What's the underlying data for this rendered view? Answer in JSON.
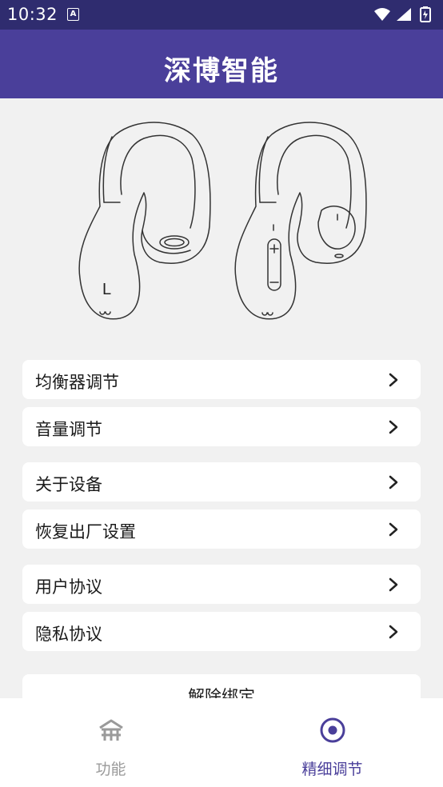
{
  "status_bar": {
    "time": "10:32",
    "notification_icon": "a-notification-icon"
  },
  "app_bar": {
    "title": "深博智能"
  },
  "illustration": {
    "left_marker": "L"
  },
  "menu": {
    "items": [
      {
        "label": "均衡器调节"
      },
      {
        "label": "音量调节"
      },
      {
        "label": "关于设备"
      },
      {
        "label": "恢复出厂设置"
      },
      {
        "label": "用户协议"
      },
      {
        "label": "隐私协议"
      }
    ],
    "unbind_label": "解除绑定"
  },
  "bottom_nav": {
    "items": [
      {
        "label": "功能",
        "icon": "home-icon",
        "active": false
      },
      {
        "label": "精细调节",
        "icon": "target-icon",
        "active": true
      }
    ]
  },
  "colors": {
    "status_bar": "#2f2c6f",
    "app_bar": "#4a3f9a",
    "active_nav": "#4a3f9a",
    "inactive_nav": "#9a9a9a"
  }
}
